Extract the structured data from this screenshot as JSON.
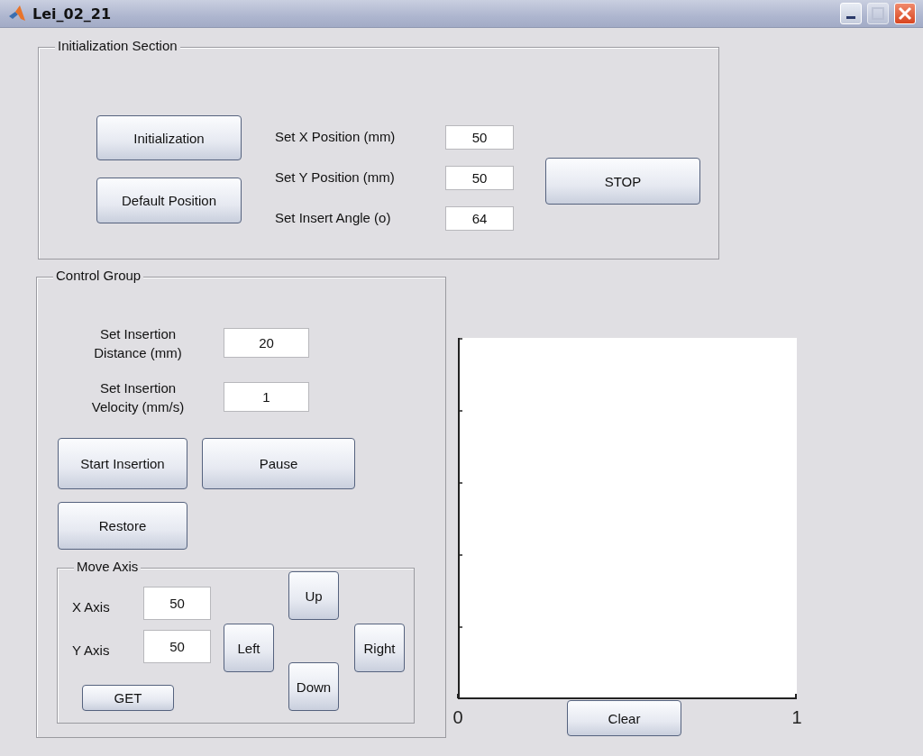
{
  "window": {
    "title": "Lei_02_21"
  },
  "initialization_section": {
    "title": "Initialization Section",
    "buttons": [
      "Initialization",
      "Default Position"
    ],
    "fields": [
      {
        "label": "Set X Position (mm)",
        "value": "50"
      },
      {
        "label": "Set Y Position (mm)",
        "value": "50"
      },
      {
        "label": "Set Insert Angle (o)",
        "value": "64"
      }
    ],
    "stop_button": "STOP"
  },
  "control_group": {
    "title": "Control Group",
    "fields": [
      {
        "label": "Set Insertion Distance (mm)",
        "value": "20"
      },
      {
        "label": "Set Insertion Velocity (mm/s)",
        "value": "1"
      }
    ],
    "buttons": [
      "Start Insertion",
      "Pause",
      "Restore"
    ],
    "move_axis": {
      "title": "Move Axis",
      "fields": [
        {
          "label": "X Axis",
          "value": "50"
        },
        {
          "label": "Y Axis",
          "value": "50"
        }
      ],
      "get_button": "GET",
      "direction_buttons": [
        "Up",
        "Left",
        "Right",
        "Down"
      ]
    }
  },
  "axes": {
    "x_tick_labels": [
      "0",
      "1"
    ],
    "clear_button": "Clear"
  }
}
